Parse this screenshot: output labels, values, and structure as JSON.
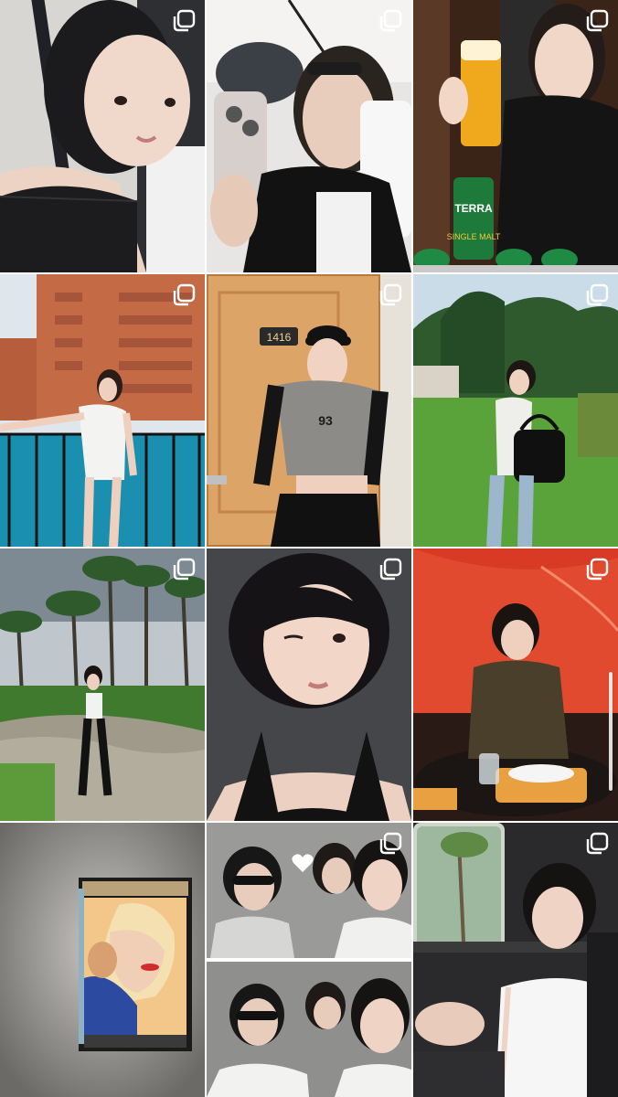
{
  "colors": {
    "background": "#ffffff",
    "multi_icon": "#ffffff"
  },
  "posts": [
    {
      "scene": "selfie-car-black-top",
      "icon": "multiple-posts-icon"
    },
    {
      "scene": "mirror-selfie-bucket-hat",
      "icon": "multiple-posts-icon"
    },
    {
      "scene": "beer-toast-black-top",
      "icon": "multiple-posts-icon",
      "brand_text": "TERRA",
      "can_text": "SINGLE MALT"
    },
    {
      "scene": "pool-balcony-swimsuit",
      "icon": "multiple-posts-icon"
    },
    {
      "scene": "hotel-door-cap-jersey",
      "icon": "multiple-posts-icon",
      "door_number": "1416",
      "jersey_number": "93"
    },
    {
      "scene": "garden-handbag",
      "icon": "multiple-posts-icon"
    },
    {
      "scene": "palm-trees-path",
      "icon": "multiple-posts-icon"
    },
    {
      "scene": "closeup-wink-selfie",
      "icon": "multiple-posts-icon"
    },
    {
      "scene": "red-restaurant-table",
      "icon": "multiple-posts-icon"
    },
    {
      "scene": "framed-pop-art",
      "icon": "none"
    },
    {
      "scene": "car-friends-collage",
      "icon": "multiple-posts-icon"
    },
    {
      "scene": "van-window-white-top",
      "icon": "multiple-posts-icon"
    }
  ]
}
